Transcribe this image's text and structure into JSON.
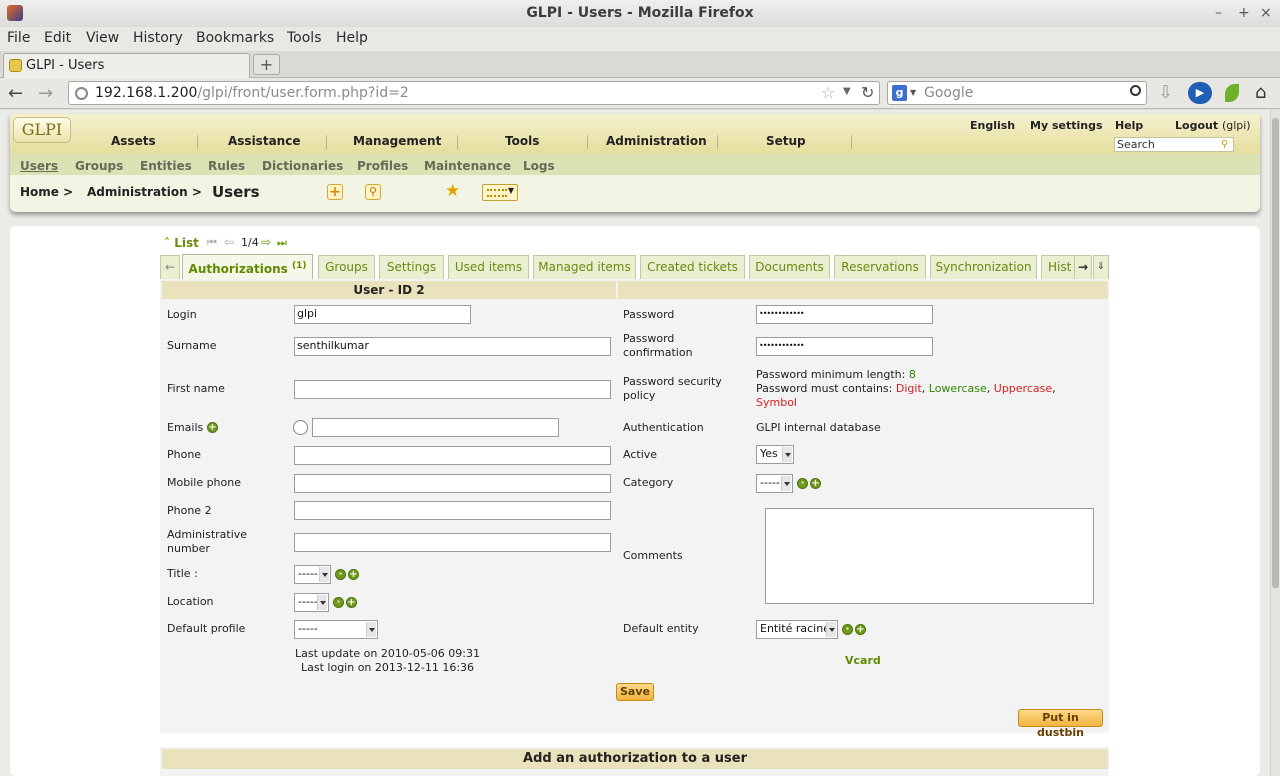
{
  "window": {
    "title": "GLPI - Users - Mozilla Firefox"
  },
  "menubar": [
    "File",
    "Edit",
    "View",
    "History",
    "Bookmarks",
    "Tools",
    "Help"
  ],
  "browser": {
    "tab_title": "GLPI - Users",
    "url_host": "192.168.1.200",
    "url_path": "/glpi/front/user.form.php?id=2",
    "search_placeholder": "Google"
  },
  "glpi": {
    "logo": "GLPI",
    "top_links": {
      "language": "English",
      "settings": "My settings",
      "help": "Help",
      "logout": "Logout",
      "user": "(glpi)"
    },
    "search_placeholder": "Search",
    "main_menu": [
      "Assets",
      "Assistance",
      "Management",
      "Tools",
      "Administration",
      "Setup"
    ],
    "sub_menu": [
      "Users",
      "Groups",
      "Entities",
      "Rules",
      "Dictionaries",
      "Profiles",
      "Maintenance",
      "Logs"
    ],
    "breadcrumb": {
      "home": "Home >",
      "admin": "Administration >",
      "current": "Users"
    }
  },
  "nav": {
    "list": "List",
    "position": "1/4"
  },
  "tabs": [
    {
      "label": "Authorizations",
      "count": "(1)"
    },
    {
      "label": "Groups"
    },
    {
      "label": "Settings"
    },
    {
      "label": "Used items"
    },
    {
      "label": "Managed items"
    },
    {
      "label": "Created tickets"
    },
    {
      "label": "Documents"
    },
    {
      "label": "Reservations"
    },
    {
      "label": "Synchronization"
    },
    {
      "label": "Hist"
    }
  ],
  "form": {
    "header": "User - ID 2",
    "left": {
      "login": {
        "label": "Login",
        "value": "glpi"
      },
      "surname": {
        "label": "Surname",
        "value": "senthilkumar"
      },
      "firstname": {
        "label": "First name",
        "value": ""
      },
      "emails": {
        "label": "Emails",
        "value": ""
      },
      "phone": {
        "label": "Phone",
        "value": ""
      },
      "mobile": {
        "label": "Mobile phone",
        "value": ""
      },
      "phone2": {
        "label": "Phone 2",
        "value": ""
      },
      "admin_number": {
        "label": "Administrative number",
        "value": ""
      },
      "title": {
        "label": "Title :",
        "value": "-----"
      },
      "location": {
        "label": "Location",
        "value": "-----"
      },
      "default_profile": {
        "label": "Default profile",
        "value": "-----"
      },
      "last_update": "Last update on 2010-05-06 09:31",
      "last_login": "Last login on 2013-12-11 16:36"
    },
    "right": {
      "password": {
        "label": "Password",
        "value": "••••••••••••"
      },
      "password_confirm": {
        "label": "Password confirmation",
        "value": "••••••••••••"
      },
      "policy": {
        "label": "Password security policy",
        "min_length_text": "Password minimum length:",
        "min_length": "8",
        "must_text": "Password must contains:",
        "digit": "Digit",
        "lowercase": "Lowercase",
        "uppercase": "Uppercase",
        "symbol": "Symbol"
      },
      "authentication": {
        "label": "Authentication",
        "value": "GLPI internal database"
      },
      "active": {
        "label": "Active",
        "value": "Yes"
      },
      "category": {
        "label": "Category",
        "value": "-----"
      },
      "comments": {
        "label": "Comments",
        "value": ""
      },
      "default_entity": {
        "label": "Default entity",
        "value": "Entité racine"
      },
      "vcard": "Vcard"
    },
    "save": "Save",
    "dustbin": "Put in dustbin"
  },
  "add_auth": {
    "header": "Add an authorization to a user"
  }
}
